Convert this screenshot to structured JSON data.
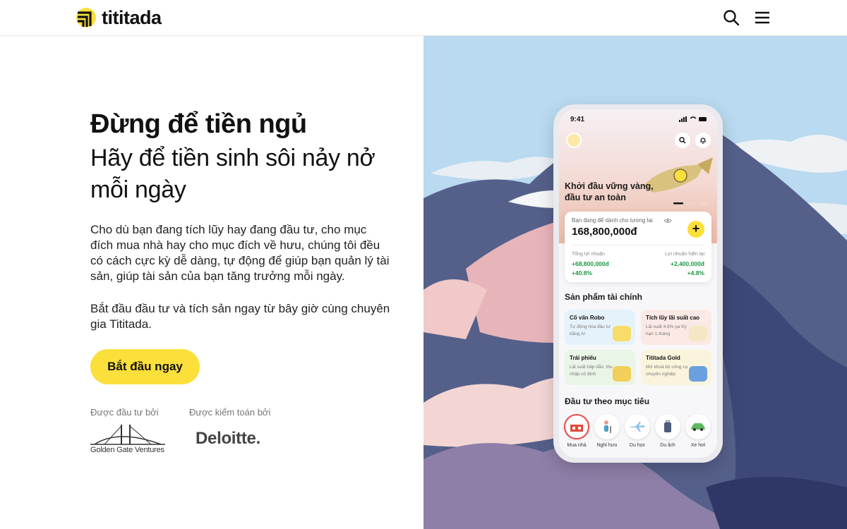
{
  "header": {
    "brand": "tititada",
    "icons": {
      "search": "search-icon",
      "menu": "menu-icon"
    }
  },
  "hero": {
    "title": "Đừng để tiền ngủ",
    "subtitle": "Hãy để tiền sinh sôi nảy nở mỗi ngày",
    "paragraph_1": "Cho dù bạn đang tích lũy hay đang đầu tư, cho mục đích mua nhà hay cho mục đích về hưu, chúng tôi đều có cách cực kỳ dễ dàng, tự động để giúp bạn quản lý tài sản, giúp tài sản của bạn tăng trưởng mỗi ngày.",
    "paragraph_2": "Bắt đầu đầu tư và tích sản ngay từ bây giờ cùng chuyên gia Tititada.",
    "cta": "Bắt đầu ngay"
  },
  "partners": {
    "invested_by_label": "Được đầu tư bởi",
    "audited_by_label": "Được kiểm toán bởi",
    "investor_name": "Golden Gate Ventures",
    "auditor_name": "Deloitte."
  },
  "phone": {
    "time": "9:41",
    "promo": "Khởi đầu vững vàng, đầu tư an toàn",
    "card": {
      "label": "Bạn đang để dành cho tương lai",
      "amount": "168,800,000đ",
      "plus": "+",
      "left_label": "Tổng lợi nhuận",
      "left_value": "+68,800,000đ",
      "left_pct": "+40.8%",
      "right_label": "Lợi nhuận hiện tại",
      "right_value": "+2,400,000đ",
      "right_pct": "+4.8%"
    },
    "products_title": "Sản phẩm tài chính",
    "products": [
      {
        "title": "Cố vấn Robo",
        "desc": "Tự động hóa đầu tư bằng AI"
      },
      {
        "title": "Tích lũy lãi suất cao",
        "desc": "Lãi suất 4.8% pa Kỳ hạn 1 tháng"
      },
      {
        "title": "Trái phiếu",
        "desc": "Lãi suất hấp dẫn, thu nhập cố định"
      },
      {
        "title": "Tititada Gold",
        "desc": "Mở khoá bộ công cụ chuyên nghiệp"
      }
    ],
    "goals_title": "Đầu tư theo mục tiêu",
    "goals": [
      {
        "label": "Mua nhà",
        "icon": "house-icon"
      },
      {
        "label": "Nghỉ hưu",
        "icon": "retirement-icon"
      },
      {
        "label": "Du học",
        "icon": "plane-icon"
      },
      {
        "label": "Du lịch",
        "icon": "suitcase-icon"
      },
      {
        "label": "Xe hơi",
        "icon": "car-icon"
      }
    ]
  },
  "colors": {
    "accent": "#fbdf3b",
    "sky": "#b9daf0",
    "positive": "#1a9a3c"
  }
}
